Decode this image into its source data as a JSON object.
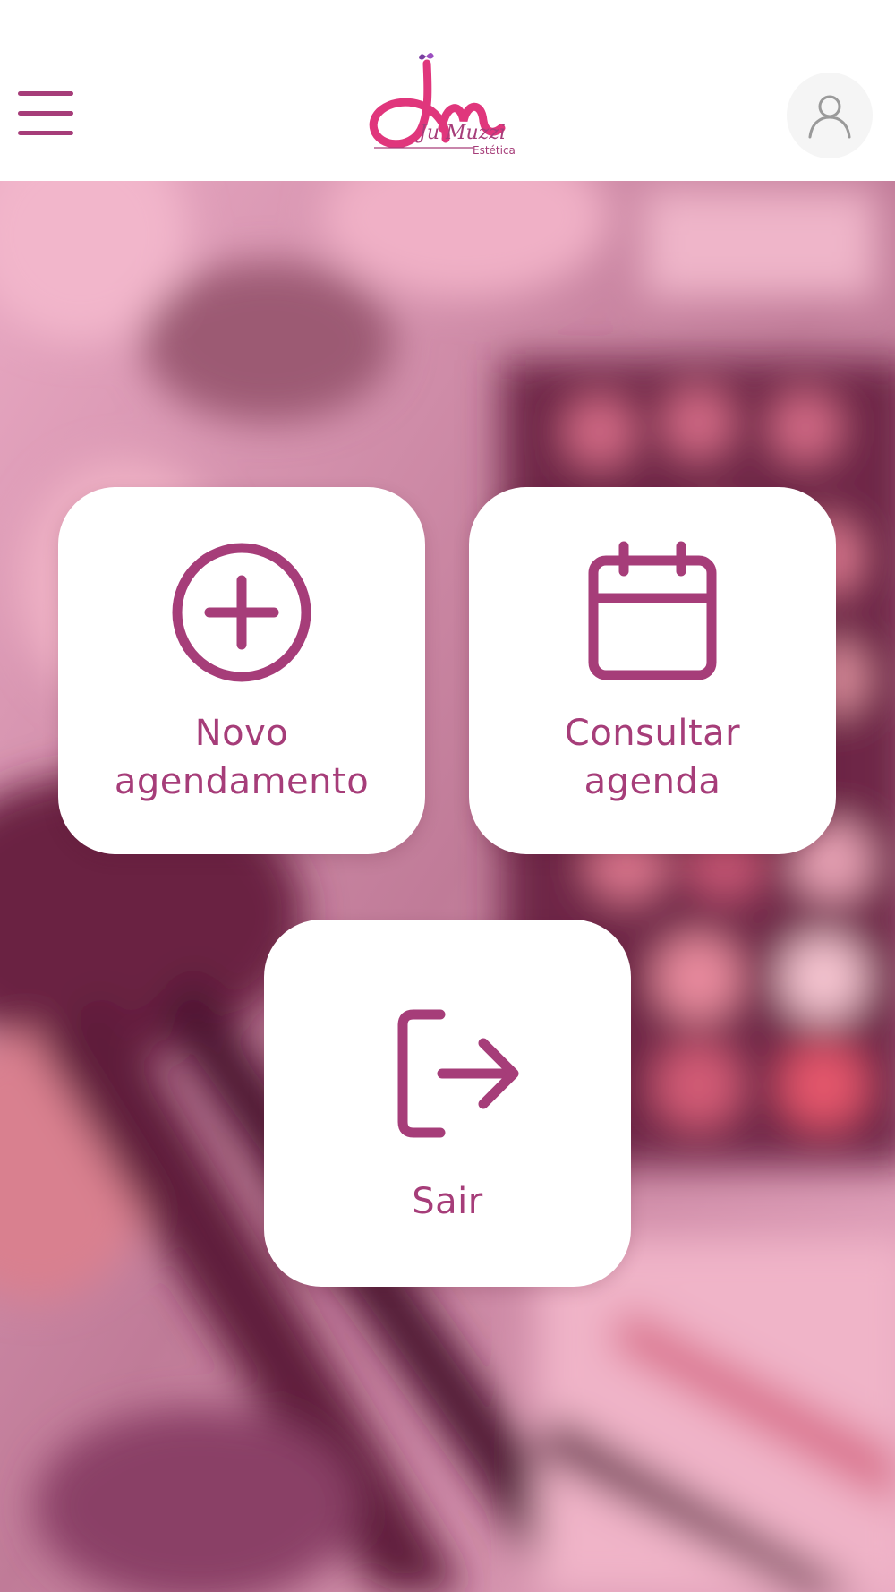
{
  "colors": {
    "brand": "#a63d79",
    "logo_pink": "#e0367c",
    "header_bg": "#ffffff",
    "card_bg": "#ffffff"
  },
  "header": {
    "menu_icon": "hamburger-menu-icon",
    "logo": {
      "name": "Ju Muzzi",
      "subtitle": "Estética"
    },
    "avatar_icon": "user-icon"
  },
  "actions": {
    "novo": {
      "icon": "plus-circle-icon",
      "label_line1": "Novo",
      "label_line2": "agendamento"
    },
    "consultar": {
      "icon": "calendar-icon",
      "label_line1": "Consultar",
      "label_line2": "agenda"
    },
    "sair": {
      "icon": "logout-icon",
      "label": "Sair"
    }
  }
}
